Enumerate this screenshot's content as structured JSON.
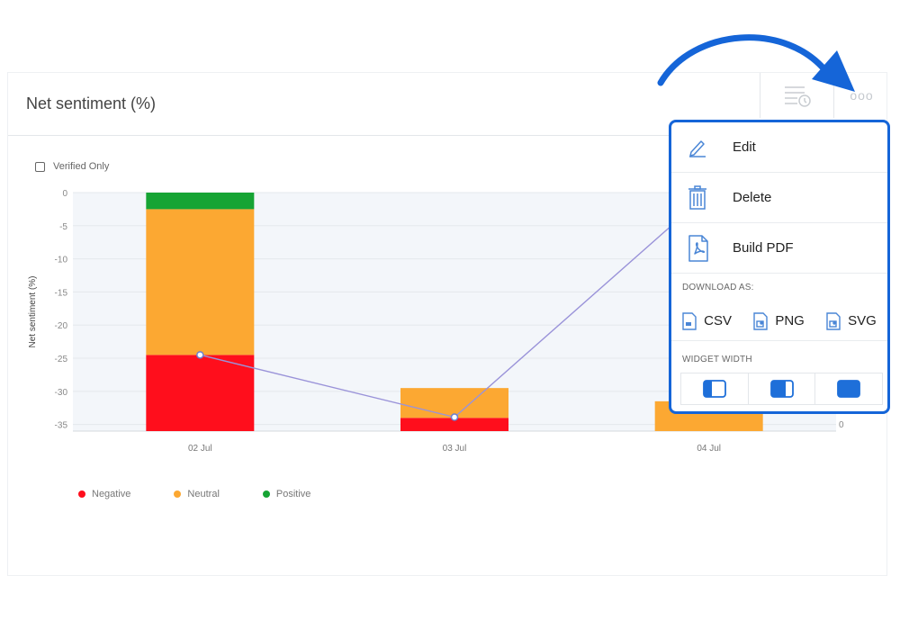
{
  "widget": {
    "title": "Net sentiment (%)",
    "verified_label": "Verified Only",
    "more_icon": "ooo"
  },
  "chart_data": {
    "type": "bar",
    "stacked": true,
    "categories": [
      "02 Jul",
      "03 Jul",
      "04 Jul"
    ],
    "series": [
      {
        "name": "Negative",
        "color": "#ff0e1c",
        "values": [
          11.5,
          2,
          0
        ]
      },
      {
        "name": "Neutral",
        "color": "#fca832",
        "values": [
          22,
          4.5,
          4.5
        ]
      },
      {
        "name": "Positive",
        "color": "#16a434",
        "values": [
          2.5,
          0,
          0
        ]
      }
    ],
    "line": {
      "color": "#9a93d9",
      "values": [
        -24.5,
        -33.9,
        0
      ]
    },
    "y_ticks": [
      "0",
      "-5",
      "-10",
      "-15",
      "-20",
      "-25",
      "-30",
      "-35"
    ],
    "ylim": [
      -36,
      0
    ],
    "ylabel": "Net sentiment (%)",
    "right_tick": "0",
    "legend_placement": "bottom-left",
    "plot_band_color": "#f3f6fa"
  },
  "menu": {
    "edit": "Edit",
    "delete": "Delete",
    "build_pdf": "Build PDF",
    "download_as": "DOWNLOAD AS:",
    "csv": "CSV",
    "png": "PNG",
    "svg": "SVG",
    "widget_width": "WIDGET WIDTH",
    "accent": "#1565d8"
  }
}
